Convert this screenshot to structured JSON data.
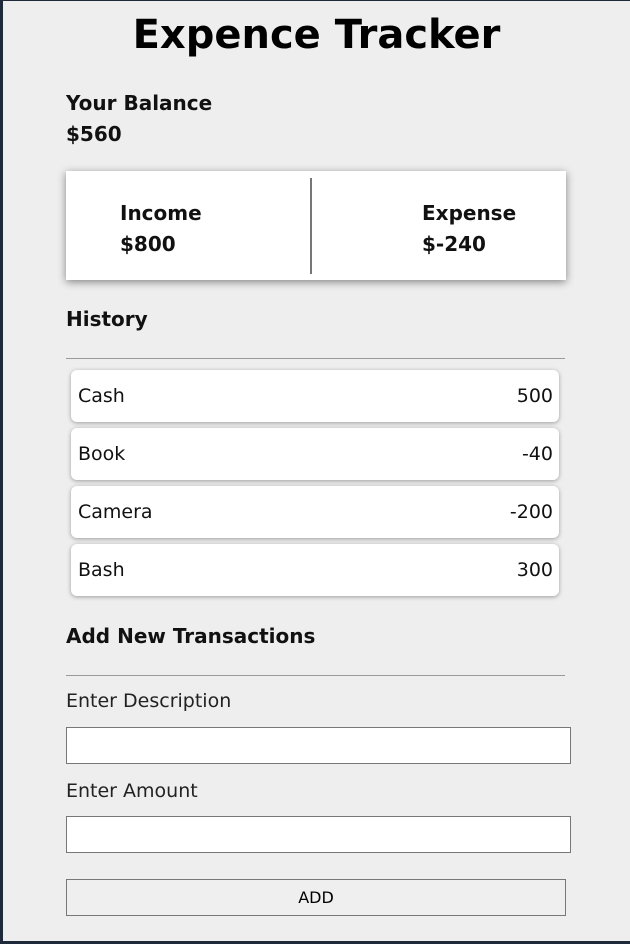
{
  "title": "Expence Tracker",
  "balance": {
    "label": "Your Balance",
    "value": "$560"
  },
  "summary": {
    "income": {
      "label": "Income",
      "value": "$800"
    },
    "expense": {
      "label": "Expense",
      "value": "$-240"
    }
  },
  "history": {
    "heading": "History",
    "items": [
      {
        "description": "Cash",
        "amount": "500"
      },
      {
        "description": "Book",
        "amount": "-40"
      },
      {
        "description": "Camera",
        "amount": "-200"
      },
      {
        "description": "Bash",
        "amount": "300"
      }
    ]
  },
  "form": {
    "heading": "Add New Transactions",
    "description_label": "Enter Description",
    "description_value": "",
    "amount_label": "Enter Amount",
    "amount_value": "",
    "add_label": "ADD"
  }
}
